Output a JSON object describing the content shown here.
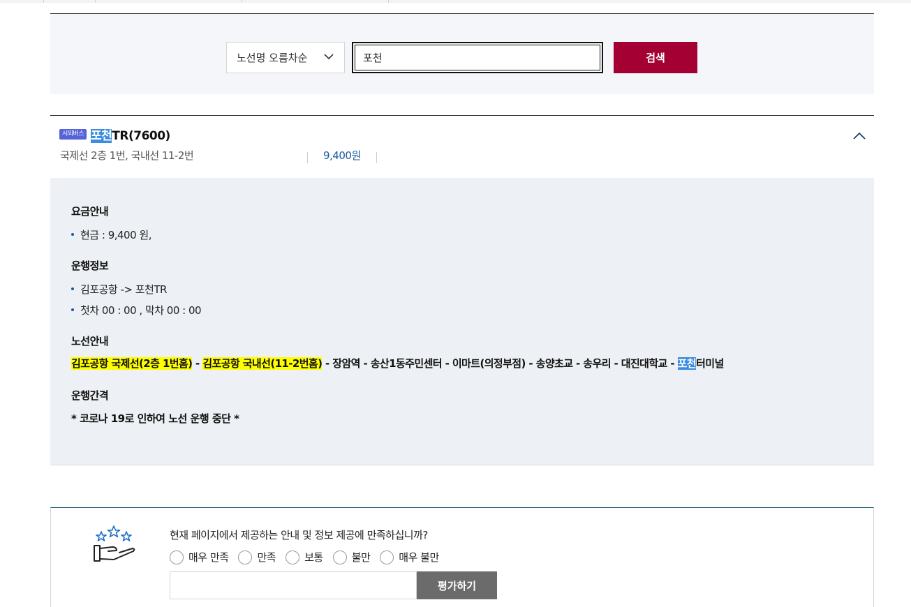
{
  "search": {
    "sort_label": "노선명 오름차순",
    "query_value": "포천",
    "search_button": "검색"
  },
  "route": {
    "badge": "시외버스",
    "title_highlight": "포천",
    "title_rest": "TR(7600)",
    "gate_info": "국제선 2층 1번, 국내선 11-2번",
    "fare": "9,400원",
    "fare_section": {
      "title": "요금안내",
      "items": [
        "현금 : 9,400 원,"
      ]
    },
    "operation_section": {
      "title": "운행정보",
      "items": [
        "김포공항 -> 포천TR",
        "첫차 00 : 00 , 막차 00 : 00"
      ]
    },
    "route_section": {
      "title": "노선안내",
      "stop_intl": "김포공항 국제선(2층 1번홈)",
      "sep1": " - ",
      "stop_dom": "김포공항 국내선(11-2번홈)",
      "middle": " - 장암역 - 송산1동주민센터 - 이마트(의정부점) - 송양초교 - 송우리 - 대진대학교 - ",
      "dest_highlight": "포천",
      "dest_rest": "터미널"
    },
    "interval_section": {
      "title": "운행간격",
      "notice": "* 코로나 19로 인하여 노선 운행 중단 *"
    }
  },
  "survey": {
    "question": "현재 페이지에서 제공하는 안내 및 정보 제공에 만족하십니까?",
    "options": [
      "매우 만족",
      "만족",
      "보통",
      "불만",
      "매우 불만"
    ],
    "submit_label": "평가하기"
  },
  "colors": {
    "primary_button": "#a50034",
    "fare_text": "#1a5a9e",
    "badge": "#5563d8",
    "highlight_search": "#3b8de0",
    "highlight_route": "#ffff00"
  }
}
